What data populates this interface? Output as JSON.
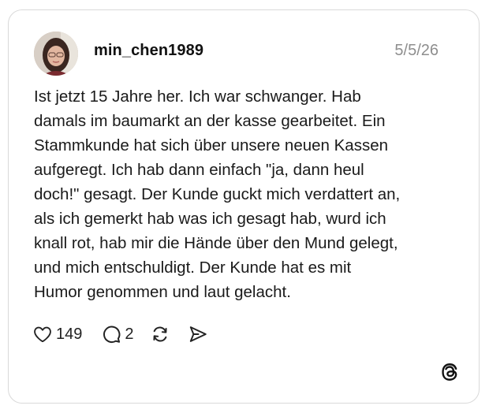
{
  "post": {
    "username": "min_chen1989",
    "date": "5/5/26",
    "text": "Ist jetzt 15 Jahre her. Ich war schwanger. Hab\ndamals im baumarkt an der kasse gearbeitet. Ein\nStammkunde hat sich über unsere neuen Kassen\naufgeregt. Ich hab dann einfach \"ja, dann heul\ndoch!\" gesagt. Der Kunde guckt mich verdattert an,\nals ich gemerkt hab was ich gesagt hab, wurd ich\nknall rot, hab mir die Hände über den Mund gelegt,\nund mich entschuldigt. Der Kunde hat es mit\nHumor genommen und laut gelacht."
  },
  "actions": {
    "likes": "149",
    "comments": "2"
  },
  "icons": {
    "like": "heart-icon",
    "comment": "comment-bubble-icon",
    "repost": "repost-icon",
    "share": "send-icon",
    "brand": "threads-logo-icon"
  }
}
